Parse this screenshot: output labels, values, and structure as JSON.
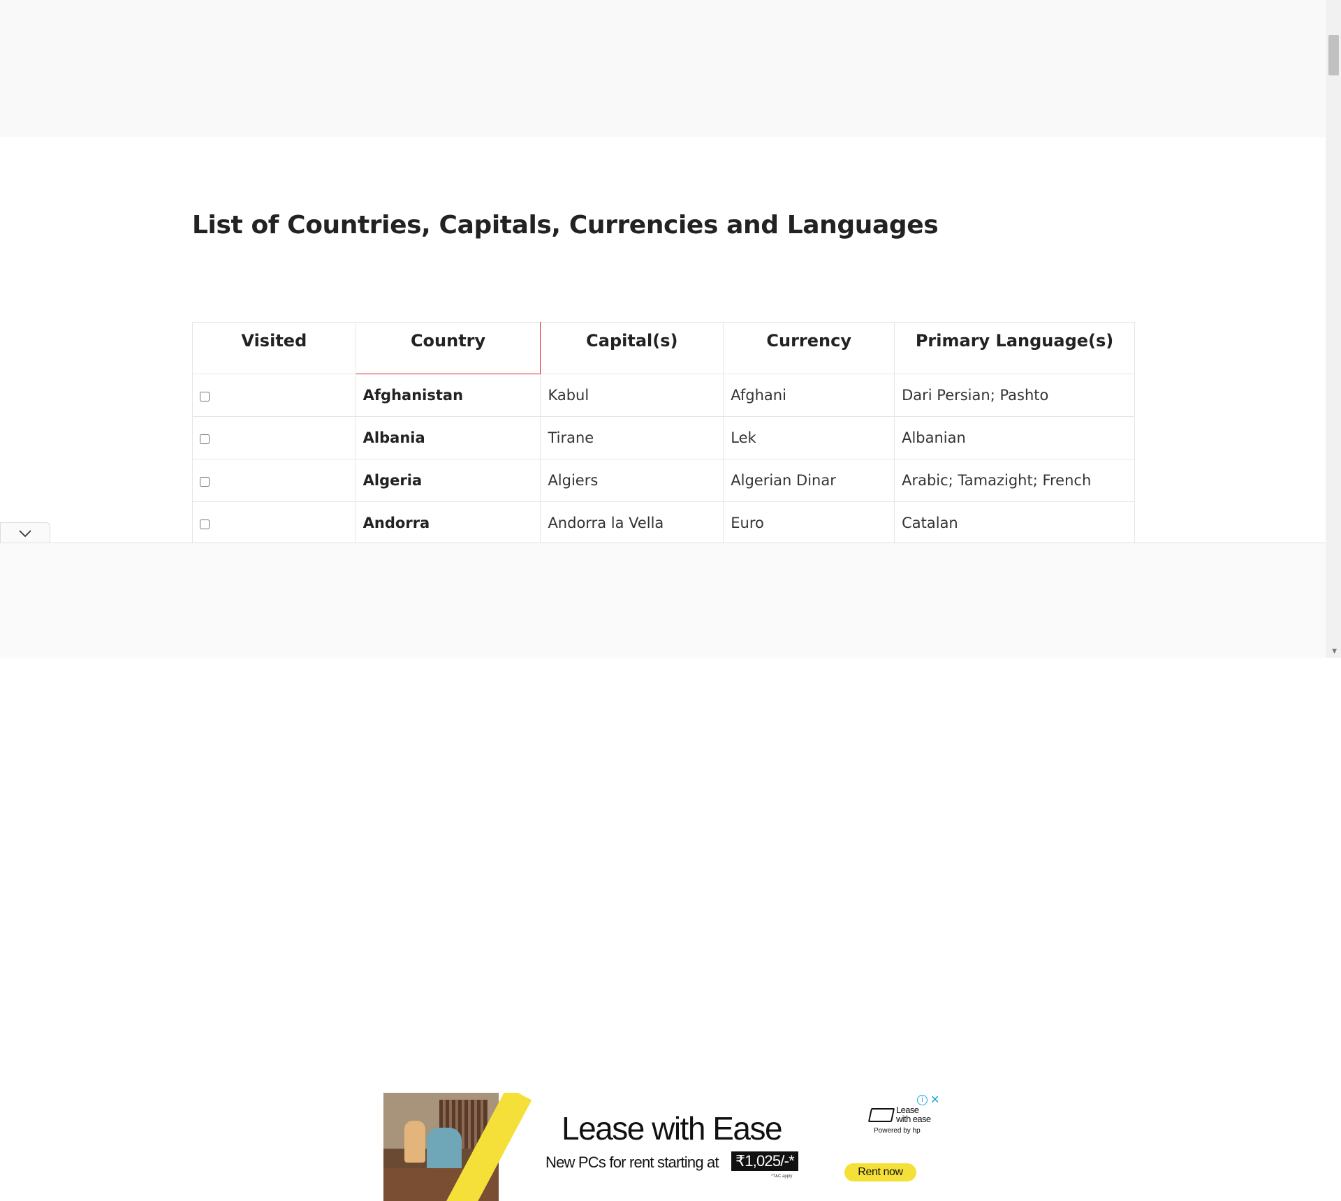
{
  "page": {
    "title": "List of Countries, Capitals, Currencies and Languages"
  },
  "table": {
    "headers": [
      "Visited",
      "Country",
      "Capital(s)",
      "Currency",
      "Primary Language(s)"
    ],
    "rows": [
      {
        "visited": false,
        "country": "Afghanistan",
        "capital": "Kabul",
        "currency": "Afghani",
        "language": "Dari Persian; Pashto"
      },
      {
        "visited": false,
        "country": "Albania",
        "capital": "Tirane",
        "currency": "Lek",
        "language": "Albanian"
      },
      {
        "visited": false,
        "country": "Algeria",
        "capital": "Algiers",
        "currency": "Algerian Dinar",
        "language": "Arabic; Tamazight; French"
      },
      {
        "visited": false,
        "country": "Andorra",
        "capital": "Andorra la Vella",
        "currency": "Euro",
        "language": "Catalan"
      }
    ]
  },
  "ad": {
    "headline": "Lease with Ease",
    "subline": "New PCs for rent starting at",
    "price": "₹1,025/-*",
    "tnc": "*T&C apply",
    "brand_line1": "Lease",
    "brand_line2": "with ease",
    "powered_by": "Powered by hp",
    "cta": "Rent now",
    "info": "i",
    "close": "✕"
  },
  "ad_toggle_icon": "chevron-down-icon",
  "colors": {
    "accent_red": "#d9232d",
    "ad_yellow": "#f5e03a",
    "ad_blue": "#1aa6d6"
  }
}
